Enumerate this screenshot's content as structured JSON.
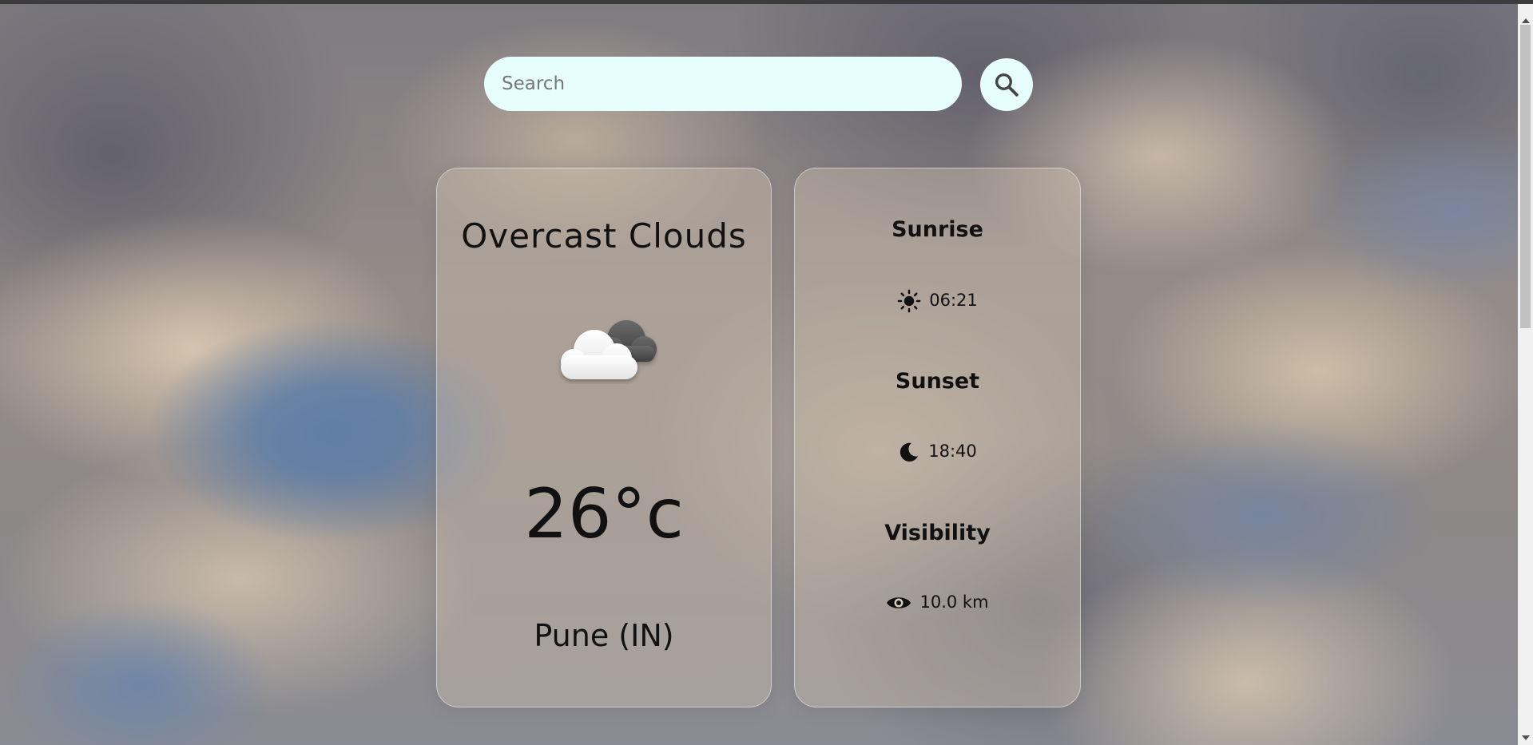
{
  "search": {
    "placeholder": "Search",
    "value": "",
    "button_icon": "search-icon"
  },
  "current_weather": {
    "condition": "Overcast Clouds",
    "icon": "cloud-icon",
    "temperature": "26°c",
    "location": "Pune (IN)"
  },
  "details": {
    "sunrise": {
      "label": "Sunrise",
      "icon": "sun-icon",
      "value": "06:21"
    },
    "sunset": {
      "label": "Sunset",
      "icon": "moon-icon",
      "value": "18:40"
    },
    "visibility": {
      "label": "Visibility",
      "icon": "eye-icon",
      "value": "10.0 km"
    }
  },
  "colors": {
    "search_bg": "#e6fffd",
    "text": "#111111",
    "card_bg": "rgba(212,196,178,0.38)"
  }
}
